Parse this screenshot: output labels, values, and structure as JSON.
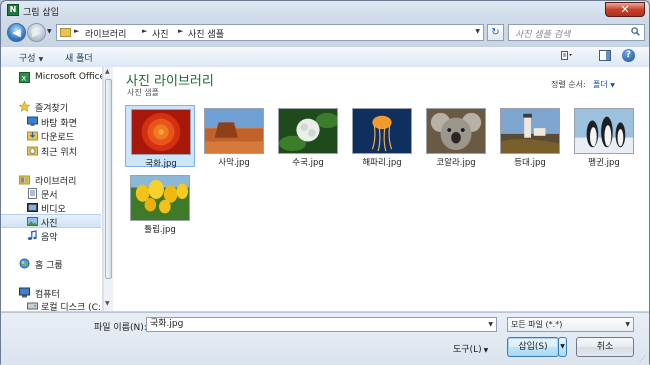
{
  "window": {
    "title": "그림 삽입",
    "close_glyph": "✕",
    "app_icon_letter": "N"
  },
  "address_bar": {
    "crumbs": [
      "라이브러리",
      "사진",
      "사진 샘플"
    ],
    "search_placeholder": "사진 샘플 검색"
  },
  "toolbar": {
    "organize": "구성",
    "new_folder": "새 폴더"
  },
  "nav": {
    "items": [
      {
        "label": "Microsoft Office Ex",
        "icon": "office-icon"
      },
      {
        "label": "즐겨찾기",
        "icon": "star-icon"
      },
      {
        "label": "바탕 화면",
        "icon": "desktop-icon"
      },
      {
        "label": "다운로드",
        "icon": "downloads-icon"
      },
      {
        "label": "최근 위치",
        "icon": "recent-places-icon"
      },
      {
        "label": "라이브러리",
        "icon": "library-icon"
      },
      {
        "label": "문서",
        "icon": "documents-icon"
      },
      {
        "label": "비디오",
        "icon": "videos-icon"
      },
      {
        "label": "사진",
        "icon": "pictures-icon",
        "selected": true
      },
      {
        "label": "음악",
        "icon": "music-icon"
      },
      {
        "label": "홈 그룹",
        "icon": "homegroup-icon"
      },
      {
        "label": "컴퓨터",
        "icon": "computer-icon"
      },
      {
        "label": "로컬 디스크 (C:)",
        "icon": "disk-icon"
      }
    ]
  },
  "content": {
    "title": "사진 라이브러리",
    "subtitle": "사진 샘플",
    "sort_label": "정렬 순서:",
    "sort_value": "폴더",
    "files": [
      {
        "name": "국화.jpg",
        "selected": true
      },
      {
        "name": "사막.jpg"
      },
      {
        "name": "수국.jpg"
      },
      {
        "name": "해파리.jpg"
      },
      {
        "name": "코알라.jpg"
      },
      {
        "name": "등대.jpg"
      },
      {
        "name": "펭귄.jpg"
      },
      {
        "name": "튤립.jpg"
      }
    ]
  },
  "bottom": {
    "file_name_label": "파일 이름(N):",
    "file_name_value": "국화.jpg",
    "file_type_value": "모든 파일 (*.*)",
    "tools_label": "도구(L)",
    "insert_label": "삽입(S)",
    "cancel_label": "취소"
  }
}
